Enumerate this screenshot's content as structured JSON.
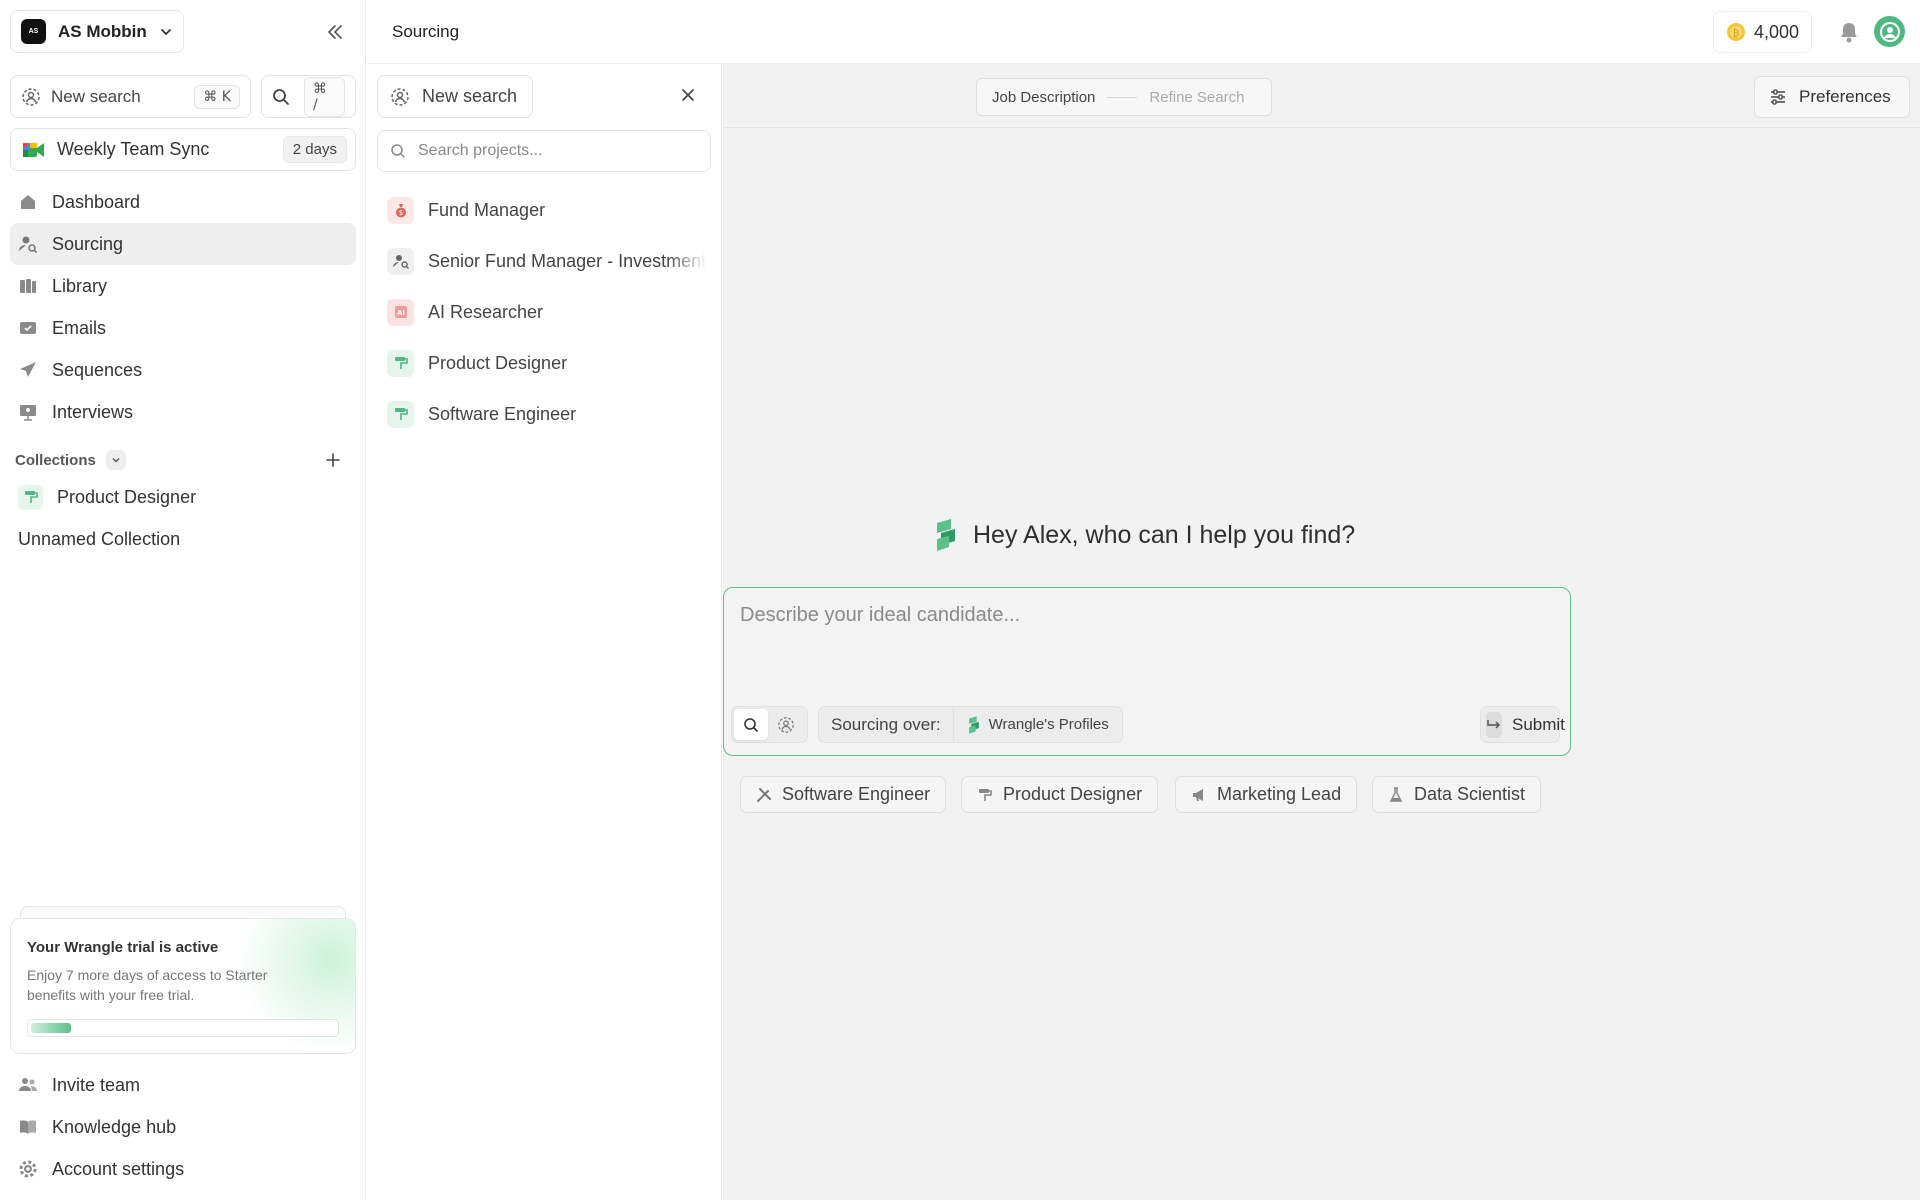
{
  "workspace": {
    "name": "AS Mobbin",
    "logo_text": "AS"
  },
  "sidebar": {
    "new_search": {
      "label": "New search",
      "shortcut": "⌘ K"
    },
    "search_shortcut": "⌘ /",
    "meeting": {
      "label": "Weekly Team Sync",
      "badge": "2 days"
    },
    "nav": [
      {
        "label": "Dashboard"
      },
      {
        "label": "Sourcing"
      },
      {
        "label": "Library"
      },
      {
        "label": "Emails"
      },
      {
        "label": "Sequences"
      },
      {
        "label": "Interviews"
      }
    ],
    "collections_label": "Collections",
    "collections": [
      {
        "label": "Product Designer"
      },
      {
        "label": "Unnamed Collection"
      }
    ],
    "trial": {
      "title": "Your Wrangle trial is active",
      "desc": "Enjoy 7 more days of access to Starter benefits with your free trial.",
      "progress": 0.13
    },
    "footer": [
      {
        "label": "Invite team"
      },
      {
        "label": "Knowledge hub"
      },
      {
        "label": "Account settings"
      }
    ]
  },
  "header": {
    "title": "Sourcing",
    "credits": "4,000"
  },
  "projects": {
    "new_search": "New search",
    "search_placeholder": "Search projects...",
    "items": [
      {
        "label": "Fund Manager"
      },
      {
        "label": "Senior Fund Manager - Investments"
      },
      {
        "label": "AI Researcher"
      },
      {
        "label": "Product Designer"
      },
      {
        "label": "Software Engineer"
      }
    ]
  },
  "main": {
    "steps": {
      "step1": "Job Description",
      "step2": "Refine Search"
    },
    "preferences": "Preferences",
    "greeting": "Hey Alex, who can I help you find?",
    "prompt_placeholder": "Describe your ideal candidate...",
    "sourcing_label": "Sourcing over:",
    "sourcing_value": "Wrangle's Profiles",
    "submit": "Submit",
    "chips": [
      {
        "label": "Software Engineer"
      },
      {
        "label": "Product Designer"
      },
      {
        "label": "Marketing Lead"
      },
      {
        "label": "Data Scientist"
      }
    ]
  },
  "colors": {
    "accent": "#4fb883",
    "background": "#f2f2f2"
  }
}
